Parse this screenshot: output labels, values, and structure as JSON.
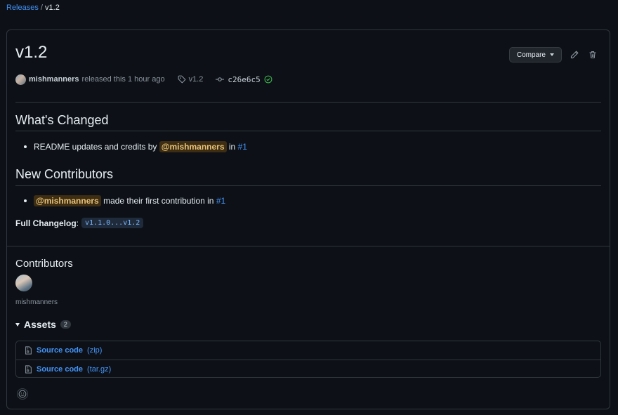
{
  "breadcrumb": {
    "releases": "Releases",
    "separator": "/",
    "current": "v1.2"
  },
  "release": {
    "title": "v1.2",
    "compare_label": "Compare",
    "author": "mishmanners",
    "released_text": "released this 1 hour ago",
    "tag": "v1.2",
    "commit": "c26e6c5"
  },
  "whats_changed": {
    "heading": "What's Changed",
    "item_text": "README updates and credits by",
    "item_mention": "@mishmanners",
    "item_in": "in",
    "item_pr": "#1"
  },
  "new_contributors": {
    "heading": "New Contributors",
    "item_mention": "@mishmanners",
    "item_text": "made their first contribution in",
    "item_pr": "#1"
  },
  "changelog": {
    "label": "Full Changelog",
    "colon": ":",
    "range": "v1.1.0...v1.2"
  },
  "contributors": {
    "heading": "Contributors",
    "name": "mishmanners"
  },
  "assets": {
    "heading": "Assets",
    "count": "2",
    "items": [
      {
        "name": "Source code",
        "ext": "(zip)"
      },
      {
        "name": "Source code",
        "ext": "(tar.gz)"
      }
    ]
  },
  "colors": {
    "background": "#0d1117",
    "link": "#4493f8",
    "border": "#30363d",
    "verified": "#3fb950"
  },
  "icons": [
    "tag-icon",
    "commit-icon",
    "verified-check-icon",
    "pencil-icon",
    "trash-icon",
    "file-zip-icon",
    "smiley-icon"
  ]
}
